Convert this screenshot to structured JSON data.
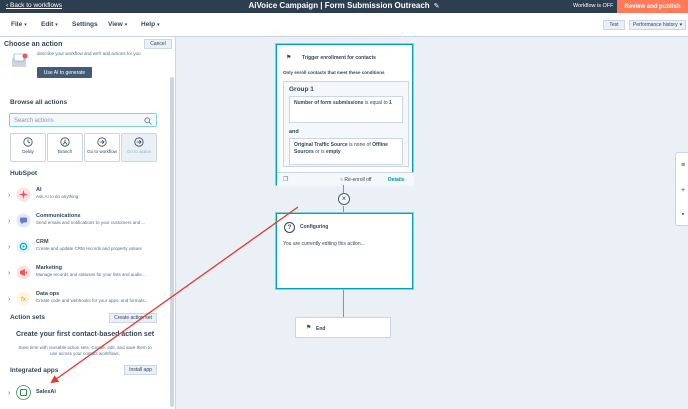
{
  "topbar": {
    "back_label": "Back to workflows",
    "title": "AiVoice Campaign | Form Submission Outreach",
    "status": "Workflow is OFF",
    "review_label": "Review and publish"
  },
  "menubar": {
    "file": "File",
    "edit": "Edit",
    "settings": "Settings",
    "view": "View",
    "help": "Help",
    "test_label": "Test",
    "performance_label": "Performance history"
  },
  "panel": {
    "title": "Choose an action",
    "cancel_label": "Cancel",
    "ai_desc": "describe your workflow and we'll add actions for you",
    "ai_button": "Use AI to generate",
    "browse_title": "Browse all actions",
    "search_placeholder": "Search actions",
    "quick_actions": [
      {
        "label": "Delay",
        "icon": "clock-icon"
      },
      {
        "label": "Branch",
        "icon": "branch-icon"
      },
      {
        "label": "Go to workflow",
        "icon": "arrow-right-icon"
      },
      {
        "label": "Go to action",
        "icon": "arrow-right-icon"
      }
    ],
    "hubspot_title": "HubSpot",
    "categories": [
      {
        "name": "AI",
        "desc": "Ask AI to do anything",
        "color": "#f2545b"
      },
      {
        "name": "Communications",
        "desc": "Send emails and notifications to your customers and ...",
        "color": "#6a78d1"
      },
      {
        "name": "CRM",
        "desc": "Create and update CRM records and property values",
        "color": "#00a4bd"
      },
      {
        "name": "Marketing",
        "desc": "Manage records and statuses for your lists and audie...",
        "color": "#f2545b"
      },
      {
        "name": "Data ops",
        "desc": "Create code and webhooks for your apps, and formats...",
        "color": "#f5c26b"
      }
    ],
    "action_sets_title": "Action sets",
    "create_set_label": "Create action set",
    "empty_title": "Create your first contact-based action set",
    "empty_desc": "Save time with reusable action sets. Create, edit, and save them to use across your contact workflows.",
    "integrated_title": "Integrated apps",
    "install_label": "Install app",
    "app_name": "SalesAi"
  },
  "trigger": {
    "title": "Trigger enrollment for contacts",
    "subtitle": "Only enroll contacts that meet these conditions",
    "group_title": "Group 1",
    "cond1_prop": "Number of form submissions",
    "cond1_op": " is equal to ",
    "cond1_val": "1",
    "and_label": "and",
    "cond2_prop": "Original Traffic Source",
    "cond2_op": " is none of ",
    "cond2_val1": "Offline Sources",
    "cond2_or": " or is ",
    "cond2_val2": "empty",
    "reenroll_label": "Re-enroll off",
    "details_label": "Details"
  },
  "configuring": {
    "title": "Configuring",
    "desc": "You are currently editing this action..."
  },
  "end": {
    "label": "End"
  },
  "colors": {
    "accent": "#ff7a59",
    "teal": "#00a4bd",
    "dark": "#2d3e50",
    "annotation_arrow": "#e8372c"
  }
}
